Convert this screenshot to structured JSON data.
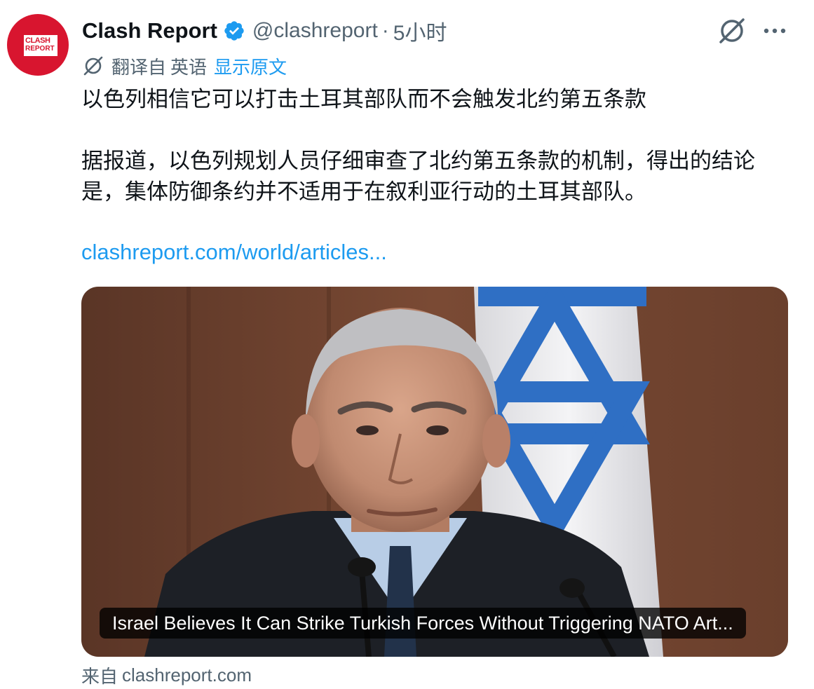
{
  "author": {
    "name": "Clash Report",
    "handle": "@clashreport",
    "separator": "·",
    "time": "5小时",
    "avatar_text_line1": "CLASH",
    "avatar_text_line2": "REPORT",
    "avatar_color": "#d8152f",
    "verified_color": "#1d9bf0"
  },
  "actions": {
    "grok_icon": "grok-slash-icon",
    "more_icon": "more-dots-icon"
  },
  "translation": {
    "label": "翻译自",
    "language": "英语",
    "show_original": "显示原文"
  },
  "tweet": {
    "title": "以色列相信它可以打击土耳其部队而不会触发北约第五条款",
    "body": "据报道，以色列规划人员仔细审查了北约第五条款的机制，得出的结论是，集体防御条约并不适用于在叙利亚行动的土耳其部队。",
    "link": "clashreport.com/world/articles..."
  },
  "card": {
    "caption": "Israel Believes It Can Strike Turkish Forces Without Triggering NATO Art..."
  },
  "source": {
    "prefix": "来自",
    "domain": "clashreport.com"
  },
  "colors": {
    "text_primary": "#0f1419",
    "text_secondary": "#536471",
    "link": "#1d9bf0"
  }
}
